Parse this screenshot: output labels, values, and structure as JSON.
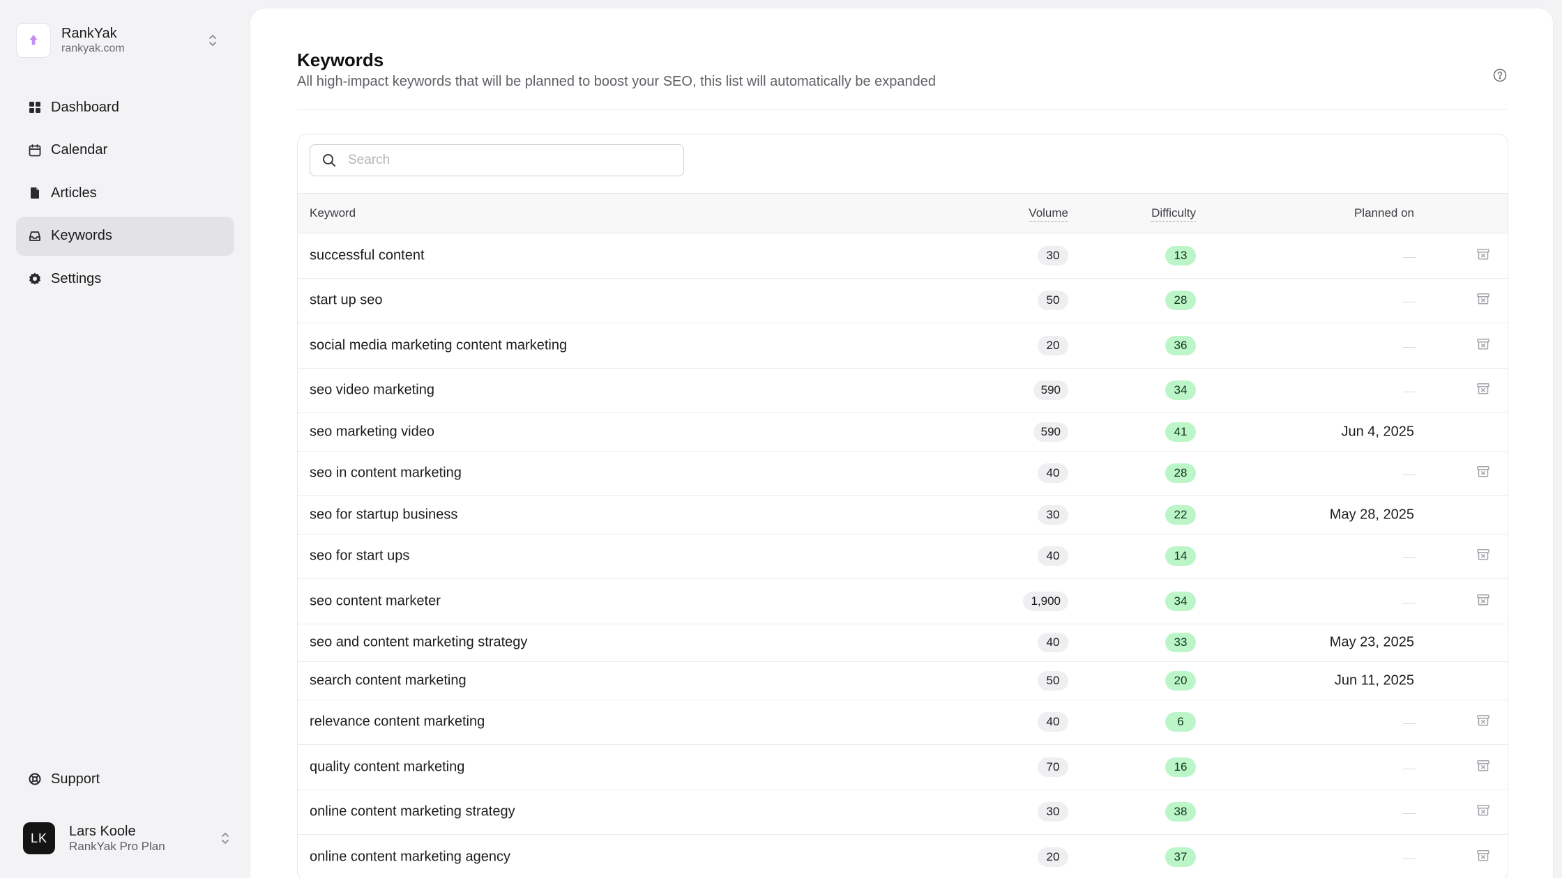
{
  "workspace": {
    "name": "RankYak",
    "url": "rankyak.com"
  },
  "nav": [
    {
      "key": "dashboard",
      "label": "Dashboard",
      "icon": "grid-icon",
      "active": false
    },
    {
      "key": "calendar",
      "label": "Calendar",
      "icon": "calendar-icon",
      "active": false
    },
    {
      "key": "articles",
      "label": "Articles",
      "icon": "document-icon",
      "active": false
    },
    {
      "key": "keywords",
      "label": "Keywords",
      "icon": "inbox-icon",
      "active": true
    },
    {
      "key": "settings",
      "label": "Settings",
      "icon": "gear-icon",
      "active": false
    }
  ],
  "support": {
    "label": "Support",
    "icon": "lifebuoy-icon"
  },
  "user": {
    "initials": "LK",
    "name": "Lars Koole",
    "plan": "RankYak Pro Plan"
  },
  "page": {
    "title": "Keywords",
    "subtitle": "All high-impact keywords that will be planned to boost your SEO, this list will automatically be expanded"
  },
  "search": {
    "placeholder": "Search",
    "value": ""
  },
  "table": {
    "columns": {
      "keyword": "Keyword",
      "volume": "Volume",
      "difficulty": "Difficulty",
      "planned": "Planned on"
    },
    "rows": [
      {
        "keyword": "successful content",
        "volume": "30",
        "difficulty": "13",
        "planned": ""
      },
      {
        "keyword": "start up seo",
        "volume": "50",
        "difficulty": "28",
        "planned": ""
      },
      {
        "keyword": "social media marketing content marketing",
        "volume": "20",
        "difficulty": "36",
        "planned": ""
      },
      {
        "keyword": "seo video marketing",
        "volume": "590",
        "difficulty": "34",
        "planned": ""
      },
      {
        "keyword": "seo marketing video",
        "volume": "590",
        "difficulty": "41",
        "planned": "Jun 4, 2025"
      },
      {
        "keyword": "seo in content marketing",
        "volume": "40",
        "difficulty": "28",
        "planned": ""
      },
      {
        "keyword": "seo for startup business",
        "volume": "30",
        "difficulty": "22",
        "planned": "May 28, 2025"
      },
      {
        "keyword": "seo for start ups",
        "volume": "40",
        "difficulty": "14",
        "planned": ""
      },
      {
        "keyword": "seo content marketer",
        "volume": "1,900",
        "difficulty": "34",
        "planned": ""
      },
      {
        "keyword": "seo and content marketing strategy",
        "volume": "40",
        "difficulty": "33",
        "planned": "May 23, 2025"
      },
      {
        "keyword": "search content marketing",
        "volume": "50",
        "difficulty": "20",
        "planned": "Jun 11, 2025"
      },
      {
        "keyword": "relevance content marketing",
        "volume": "40",
        "difficulty": "6",
        "planned": ""
      },
      {
        "keyword": "quality content marketing",
        "volume": "70",
        "difficulty": "16",
        "planned": ""
      },
      {
        "keyword": "online content marketing strategy",
        "volume": "30",
        "difficulty": "38",
        "planned": ""
      },
      {
        "keyword": "online content marketing agency",
        "volume": "20",
        "difficulty": "37",
        "planned": ""
      }
    ]
  },
  "colors": {
    "difficulty_badge": "#bcf5c8",
    "volume_badge": "#efeff1",
    "active_nav": "#e3e3e7",
    "brand_logo": "#c58ff0"
  }
}
